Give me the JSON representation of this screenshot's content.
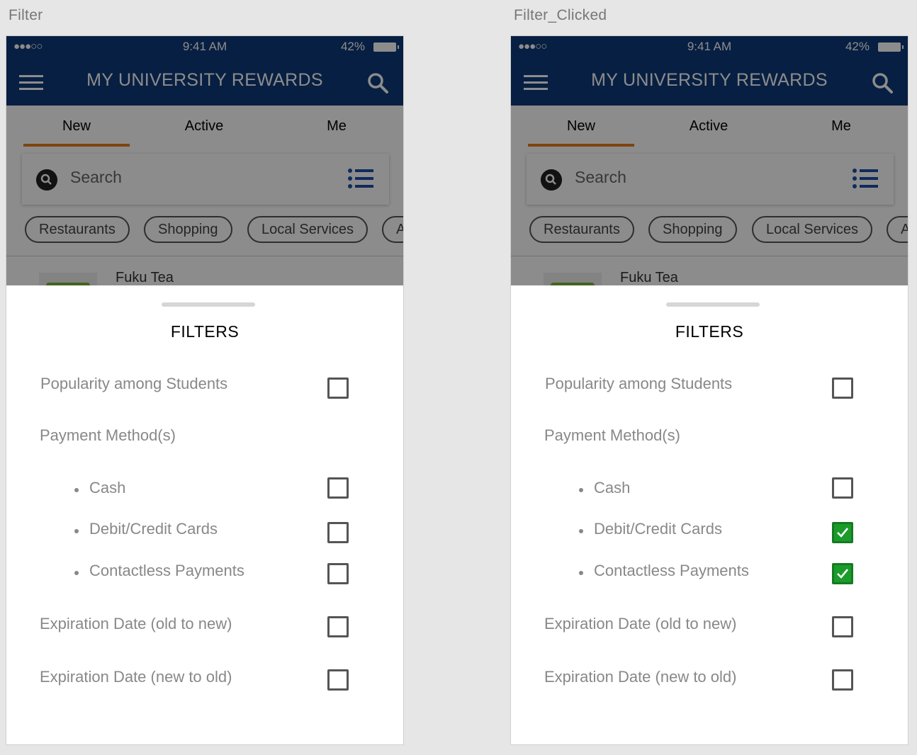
{
  "artboards": [
    {
      "label": "Filter",
      "status": {
        "time": "9:41 AM",
        "battery": "42%"
      },
      "nav": {
        "title": "MY UNIVERSITY REWARDS"
      },
      "tabs": [
        "New",
        "Active",
        "Me"
      ],
      "search": {
        "label": "Search"
      },
      "chips": [
        "Restaurants",
        "Shopping",
        "Local Services",
        "A"
      ],
      "list_item": {
        "name": "Fuku Tea"
      },
      "filters": {
        "title": "FILTERS",
        "popularity": {
          "label": "Popularity among Students",
          "checked": false
        },
        "payment_heading": "Payment Method(s)",
        "cash": {
          "label": "Cash",
          "checked": false
        },
        "cards": {
          "label": "Debit/Credit Cards",
          "checked": false
        },
        "contactless": {
          "label": "Contactless Payments",
          "checked": false
        },
        "exp_old_new": {
          "label": "Expiration Date (old to new)",
          "checked": false
        },
        "exp_new_old": {
          "label": "Expiration Date (new to old)",
          "checked": false
        }
      }
    },
    {
      "label": "Filter_Clicked",
      "status": {
        "time": "9:41 AM",
        "battery": "42%"
      },
      "nav": {
        "title": "MY UNIVERSITY REWARDS"
      },
      "tabs": [
        "New",
        "Active",
        "Me"
      ],
      "search": {
        "label": "Search"
      },
      "chips": [
        "Restaurants",
        "Shopping",
        "Local Services",
        "A"
      ],
      "list_item": {
        "name": "Fuku Tea"
      },
      "filters": {
        "title": "FILTERS",
        "popularity": {
          "label": "Popularity among Students",
          "checked": false
        },
        "payment_heading": "Payment Method(s)",
        "cash": {
          "label": "Cash",
          "checked": false
        },
        "cards": {
          "label": "Debit/Credit Cards",
          "checked": true
        },
        "contactless": {
          "label": "Contactless Payments",
          "checked": true
        },
        "exp_old_new": {
          "label": "Expiration Date (old to new)",
          "checked": false
        },
        "exp_new_old": {
          "label": "Expiration Date (new to old)",
          "checked": false
        }
      }
    }
  ],
  "colors": {
    "nav_bg": "#0e3a78",
    "tab_accent": "#e67e1a",
    "checkbox_checked": "#1a9b2a"
  }
}
